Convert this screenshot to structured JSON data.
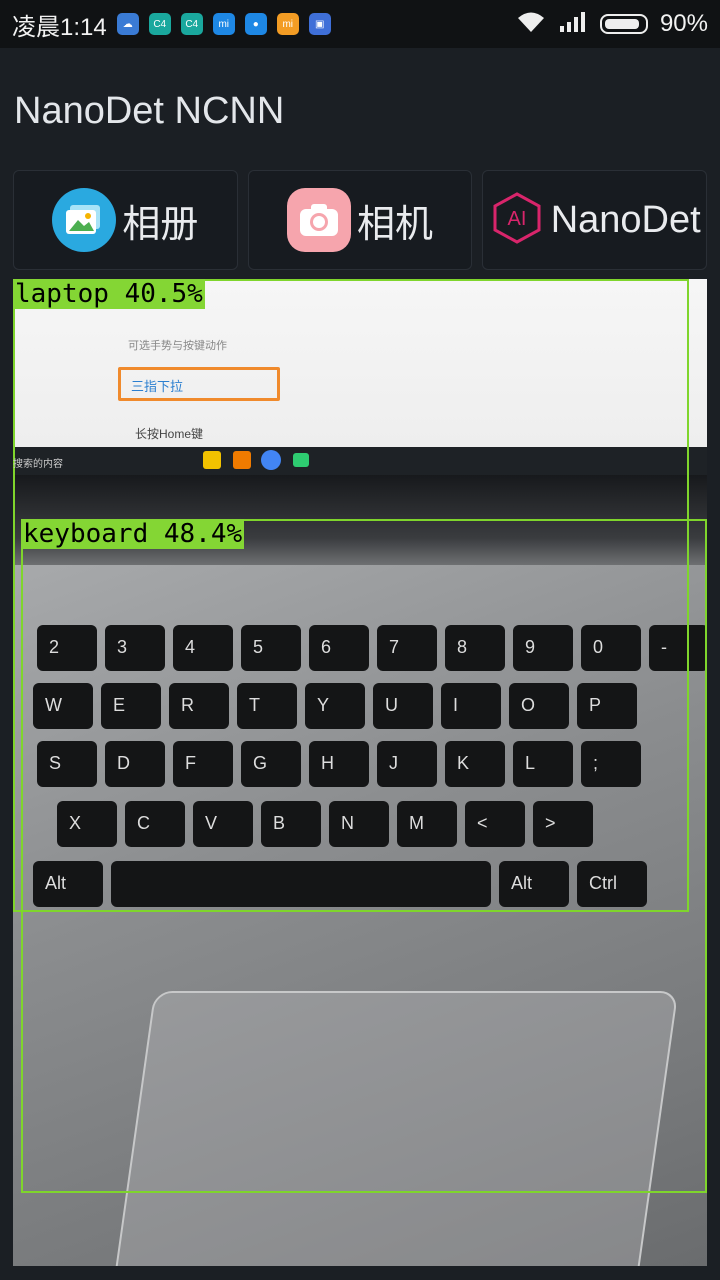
{
  "status_bar": {
    "time": "凌晨1:14",
    "app_icons": [
      {
        "name": "cloud-icon",
        "color": "#3a7bd5",
        "glyph": "☁"
      },
      {
        "name": "c4-icon-1",
        "color": "#1aa89e",
        "glyph": "C4"
      },
      {
        "name": "c4-icon-2",
        "color": "#1aa89e",
        "glyph": "C4"
      },
      {
        "name": "mi-icon",
        "color": "#1e88e5",
        "glyph": "mi"
      },
      {
        "name": "drop-icon",
        "color": "#1e88e5",
        "glyph": "●"
      },
      {
        "name": "mi-store-icon",
        "color": "#f39c24",
        "glyph": "mi"
      },
      {
        "name": "app-icon",
        "color": "#3f6fd8",
        "glyph": "▣"
      }
    ],
    "battery_percent": "90%",
    "battery_level": 0.9
  },
  "app": {
    "title": "NanoDet NCNN"
  },
  "toolbar": {
    "album_label": "相册",
    "camera_label": "相机",
    "nanodet_label": "NanoDet"
  },
  "detections": [
    {
      "label": "laptop 40.5%",
      "class": "laptop",
      "score": 40.5
    },
    {
      "label": "keyboard 48.4%",
      "class": "keyboard",
      "score": 48.4
    }
  ],
  "screen_text": {
    "line1": "可选手势与按键动作",
    "highlight": "三指下拉",
    "line2": "长按Home键",
    "side": "搜索的内容"
  },
  "keyboard_keys": {
    "row1": [
      "2",
      "3",
      "4",
      "5",
      "6",
      "7",
      "8",
      "9",
      "0",
      "-"
    ],
    "row2": [
      "W",
      "E",
      "R",
      "T",
      "Y",
      "U",
      "I",
      "O",
      "P"
    ],
    "row3": [
      "S",
      "D",
      "F",
      "G",
      "H",
      "J",
      "K",
      "L",
      ";"
    ],
    "row4": [
      "X",
      "C",
      "V",
      "B",
      "N",
      "M",
      "<",
      ">"
    ],
    "row5": [
      "Alt",
      "Alt",
      "Ctrl"
    ]
  }
}
